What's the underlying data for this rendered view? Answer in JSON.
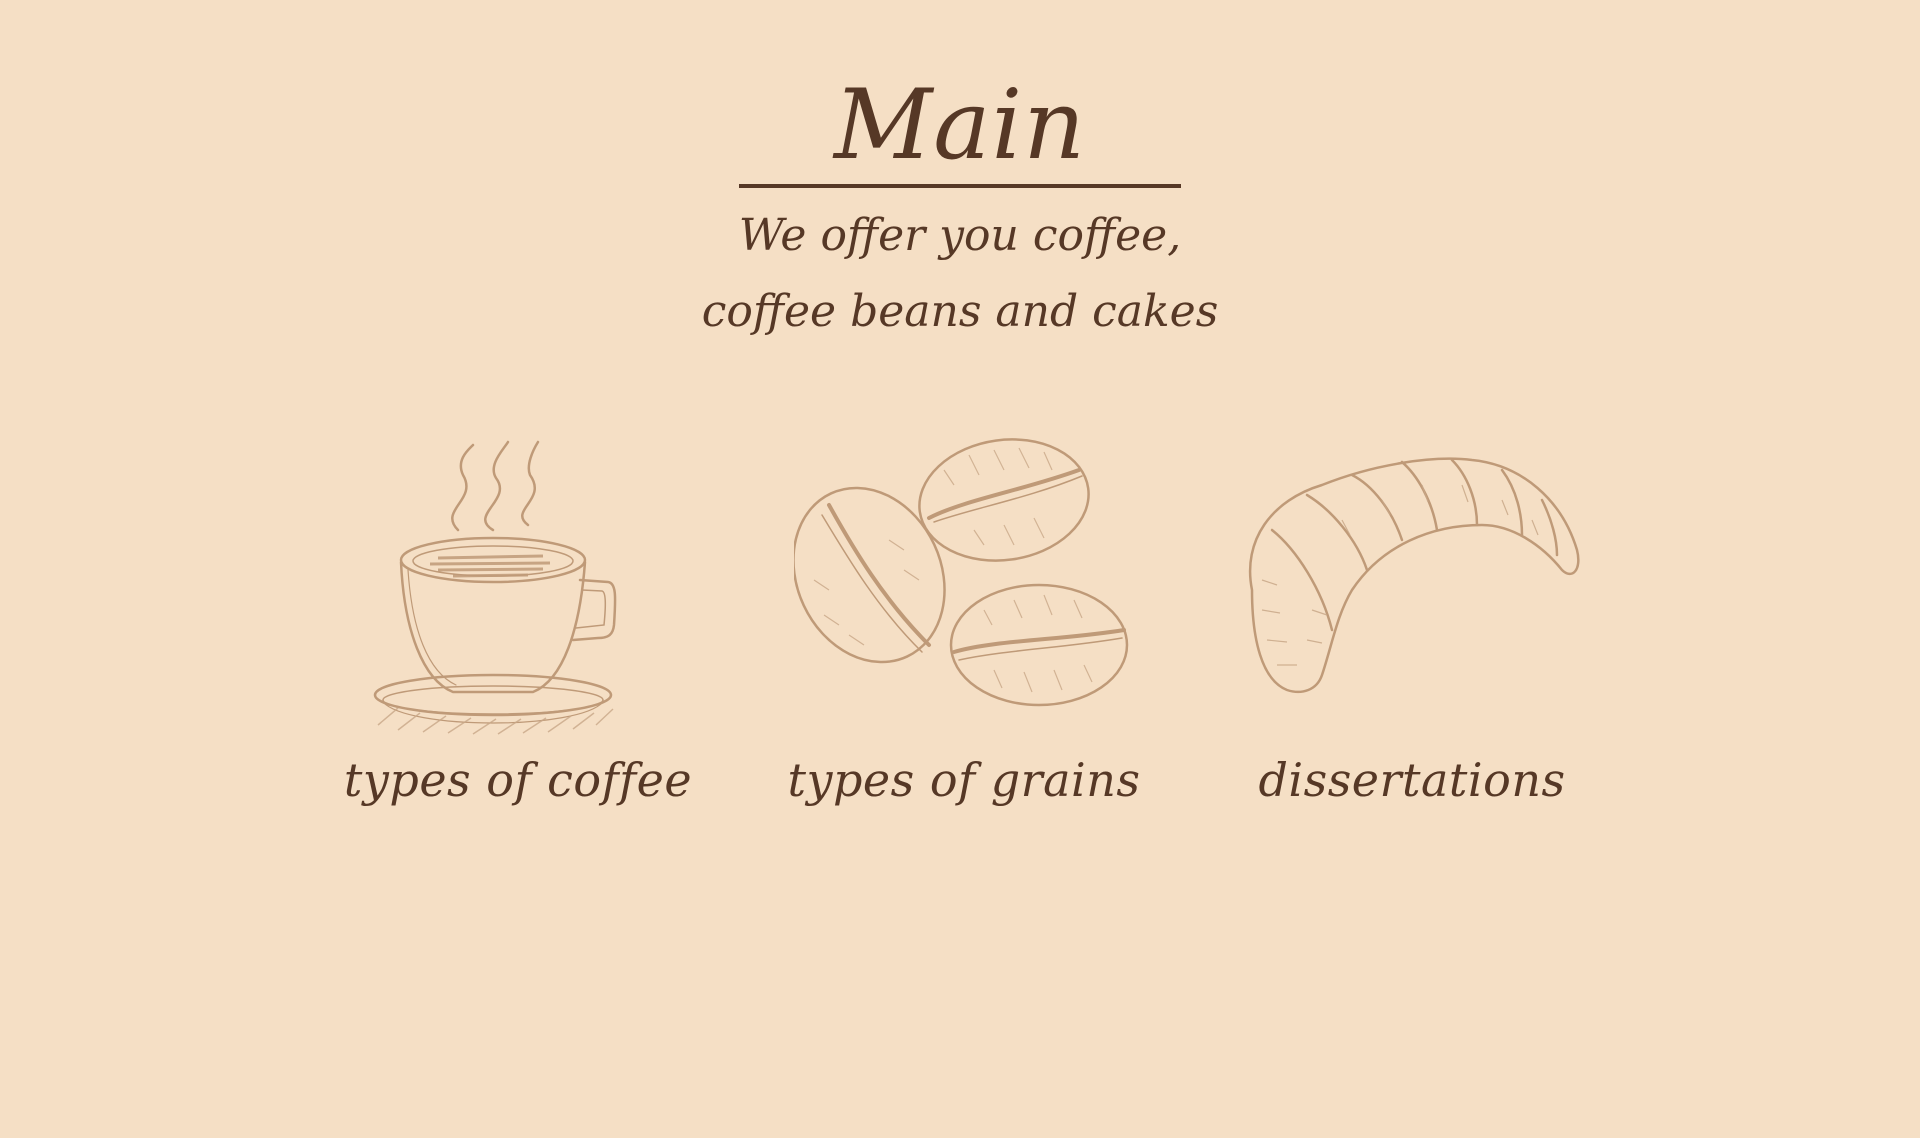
{
  "header": {
    "title": "Main",
    "subtitle_line1": "We offer you coffee,",
    "subtitle_line2": "coffee beans and cakes"
  },
  "cards": [
    {
      "icon": "coffee-cup-icon",
      "label": "types of coffee"
    },
    {
      "icon": "coffee-beans-icon",
      "label": "types of grains"
    },
    {
      "icon": "croissant-icon",
      "label": "dissertations"
    }
  ],
  "colors": {
    "background": "#f5dfc5",
    "text": "#563826",
    "sketch": "#bf9a78"
  }
}
